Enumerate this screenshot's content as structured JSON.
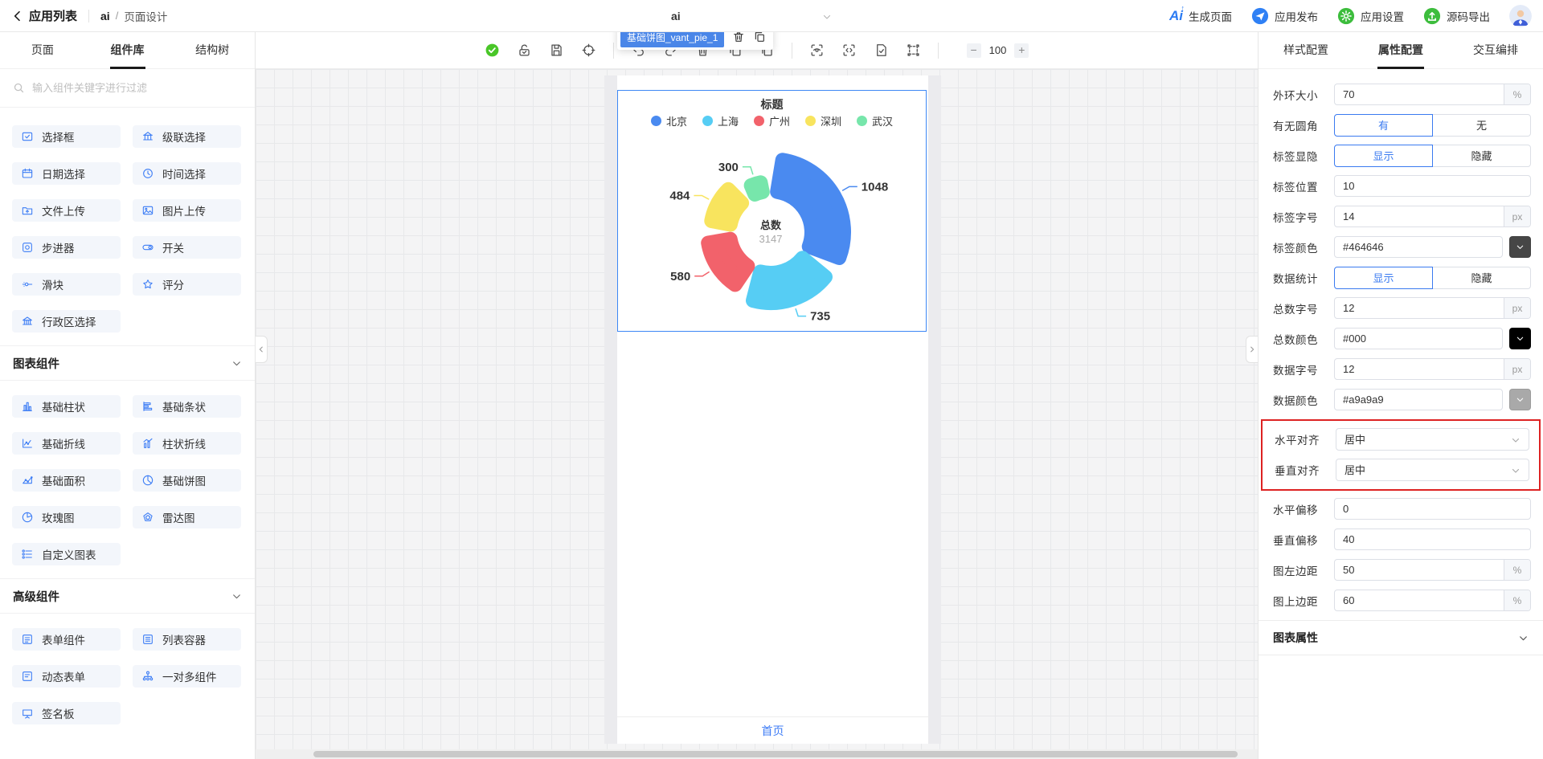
{
  "header": {
    "back_label": "应用列表",
    "app_name": "ai",
    "crumb_sep": "/",
    "page_name": "页面设计",
    "page_selector": "ai",
    "actions": [
      {
        "key": "generate-page",
        "icon": "ai-logo-icon",
        "label": "生成页面"
      },
      {
        "key": "publish-app",
        "icon": "paper-plane-icon",
        "label": "应用发布",
        "color": "#2f80f5"
      },
      {
        "key": "app-settings",
        "icon": "gear-icon",
        "label": "应用设置",
        "color": "#3dbd3d"
      },
      {
        "key": "export-source",
        "icon": "export-icon",
        "label": "源码导出",
        "color": "#3dbd3d"
      }
    ]
  },
  "sidebar": {
    "tabs": [
      {
        "label": "页面",
        "active": false
      },
      {
        "label": "组件库",
        "active": true
      },
      {
        "label": "结构树",
        "active": false
      }
    ],
    "search_placeholder": "输入组件关键字进行过滤",
    "sections": [
      {
        "title": "",
        "items": [
          {
            "icon": "checkbox-icon",
            "label": "选择框"
          },
          {
            "icon": "cascade-select-icon",
            "label": "级联选择"
          },
          {
            "icon": "date-picker-icon",
            "label": "日期选择"
          },
          {
            "icon": "time-picker-icon",
            "label": "时间选择"
          },
          {
            "icon": "file-upload-icon",
            "label": "文件上传"
          },
          {
            "icon": "image-upload-icon",
            "label": "图片上传"
          },
          {
            "icon": "stepper-icon",
            "label": "步进器"
          },
          {
            "icon": "switch-icon",
            "label": "开关"
          },
          {
            "icon": "slider-icon",
            "label": "滑块"
          },
          {
            "icon": "rate-icon",
            "label": "评分"
          },
          {
            "icon": "region-select-icon",
            "label": "行政区选择"
          }
        ]
      },
      {
        "title": "图表组件",
        "items": [
          {
            "icon": "bar-chart-icon",
            "label": "基础柱状"
          },
          {
            "icon": "bar-horizontal-icon",
            "label": "基础条状"
          },
          {
            "icon": "line-chart-icon",
            "label": "基础折线"
          },
          {
            "icon": "combo-chart-icon",
            "label": "柱状折线"
          },
          {
            "icon": "area-chart-icon",
            "label": "基础面积"
          },
          {
            "icon": "pie-chart-icon",
            "label": "基础饼图"
          },
          {
            "icon": "rose-chart-icon",
            "label": "玫瑰图"
          },
          {
            "icon": "radar-chart-icon",
            "label": "雷达图"
          },
          {
            "icon": "custom-chart-icon",
            "label": "自定义图表"
          }
        ]
      },
      {
        "title": "高级组件",
        "items": [
          {
            "icon": "form-icon",
            "label": "表单组件"
          },
          {
            "icon": "list-container-icon",
            "label": "列表容器"
          },
          {
            "icon": "dynamic-form-icon",
            "label": "动态表单"
          },
          {
            "icon": "one-to-many-icon",
            "label": "一对多组件"
          },
          {
            "icon": "signature-icon",
            "label": "签名板"
          }
        ]
      }
    ]
  },
  "toolbar": {
    "icons": [
      "status-check-icon",
      "unlock-icon",
      "save-icon",
      "target-icon",
      "sep",
      "undo-icon",
      "redo-icon",
      "trash-icon",
      "page-remove-icon",
      "paste-icon",
      "sep",
      "preview-icon",
      "code-view-icon",
      "page-check-icon",
      "frame-select-icon",
      "sep"
    ],
    "zoom_out": "−",
    "zoom": "100",
    "zoom_in": "+"
  },
  "canvas": {
    "selected_component": "基础饼图_vant_pie_1",
    "page_footer": "首页"
  },
  "panel": {
    "tabs": [
      {
        "label": "样式配置",
        "active": false
      },
      {
        "label": "属性配置",
        "active": true
      },
      {
        "label": "交互编排",
        "active": false
      }
    ],
    "highlight_color": "#dd2222",
    "rows": [
      {
        "key": "outer-ring-size",
        "type": "input",
        "label": "外环大小",
        "value": "70",
        "suffix": "%"
      },
      {
        "key": "rounded-corner",
        "type": "toggle",
        "label": "有无圆角",
        "options": [
          "有",
          "无"
        ],
        "selected": 0
      },
      {
        "key": "label-visibility",
        "type": "toggle",
        "label": "标签显隐",
        "options": [
          "显示",
          "隐藏"
        ],
        "selected": 0
      },
      {
        "key": "label-position",
        "type": "input",
        "label": "标签位置",
        "value": "10"
      },
      {
        "key": "label-font-size",
        "type": "input",
        "label": "标签字号",
        "value": "14",
        "suffix": "px"
      },
      {
        "key": "label-color",
        "type": "color",
        "label": "标签颜色",
        "value": "#464646"
      },
      {
        "key": "data-summary",
        "type": "toggle",
        "label": "数据统计",
        "options": [
          "显示",
          "隐藏"
        ],
        "selected": 0
      },
      {
        "key": "total-font-size",
        "type": "input",
        "label": "总数字号",
        "value": "12",
        "suffix": "px"
      },
      {
        "key": "total-color",
        "type": "color",
        "label": "总数颜色",
        "value": "#000"
      },
      {
        "key": "data-font-size",
        "type": "input",
        "label": "数据字号",
        "value": "12",
        "suffix": "px"
      },
      {
        "key": "data-color",
        "type": "color",
        "label": "数据颜色",
        "value": "#a9a9a9"
      },
      {
        "key": "horizontal-align",
        "type": "select",
        "label": "水平对齐",
        "value": "居中",
        "highlighted": true
      },
      {
        "key": "vertical-align",
        "type": "select",
        "label": "垂直对齐",
        "value": "居中",
        "highlighted": true
      },
      {
        "key": "horizontal-offset",
        "type": "input",
        "label": "水平偏移",
        "value": "0"
      },
      {
        "key": "vertical-offset",
        "type": "input",
        "label": "垂直偏移",
        "value": "40"
      },
      {
        "key": "chart-left-margin",
        "type": "input",
        "label": "图左边距",
        "value": "50",
        "suffix": "%"
      },
      {
        "key": "chart-top-margin",
        "type": "input",
        "label": "图上边距",
        "value": "60",
        "suffix": "%"
      }
    ],
    "section_title": "图表属性"
  },
  "chart_data": {
    "type": "pie",
    "variant": "rose-donut",
    "title": "标题",
    "categories": [
      "北京",
      "上海",
      "广州",
      "深圳",
      "武汉"
    ],
    "values": [
      1048,
      735,
      580,
      484,
      300
    ],
    "colors": [
      "#4a8af0",
      "#56cdf4",
      "#f2626b",
      "#f8e45e",
      "#77e6ab"
    ],
    "center_label": "总数",
    "center_value": "3147",
    "legend_position": "top",
    "inner_radius_px": 42,
    "outer_radius_px": [
      100,
      97,
      88,
      84,
      72
    ],
    "value_label_color": "#333333",
    "center_value_color": "#a9a9a9"
  }
}
